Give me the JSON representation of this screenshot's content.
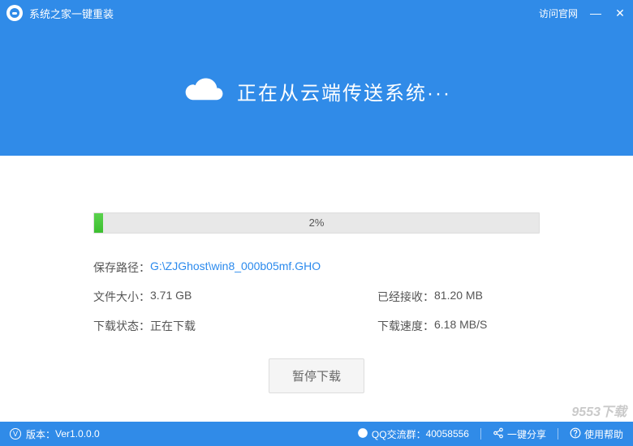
{
  "titlebar": {
    "app_title": "系统之家一键重装",
    "visit_link": "访问官网",
    "minimize": "—",
    "close": "✕"
  },
  "hero": {
    "message": "正在从云端传送系统···"
  },
  "progress": {
    "percent_label": "2%",
    "fill_width": "2%"
  },
  "info": {
    "save_path_label": "保存路径：",
    "save_path_value": "G:\\ZJGhost\\win8_000b05mf.GHO",
    "file_size_label": "文件大小：",
    "file_size_value": "3.71 GB",
    "received_label": "已经接收：",
    "received_value": "81.20 MB",
    "status_label": "下载状态：",
    "status_value": "正在下载",
    "speed_label": "下载速度：",
    "speed_value": "6.18 MB/S"
  },
  "buttons": {
    "pause": "暂停下载"
  },
  "footer": {
    "version_icon": "V",
    "version_label": "版本：",
    "version_value": "Ver1.0.0.0",
    "qq_label": "QQ交流群：",
    "qq_value": "40058556",
    "share": "一键分享",
    "help": "使用帮助"
  },
  "watermark": "9553下载"
}
